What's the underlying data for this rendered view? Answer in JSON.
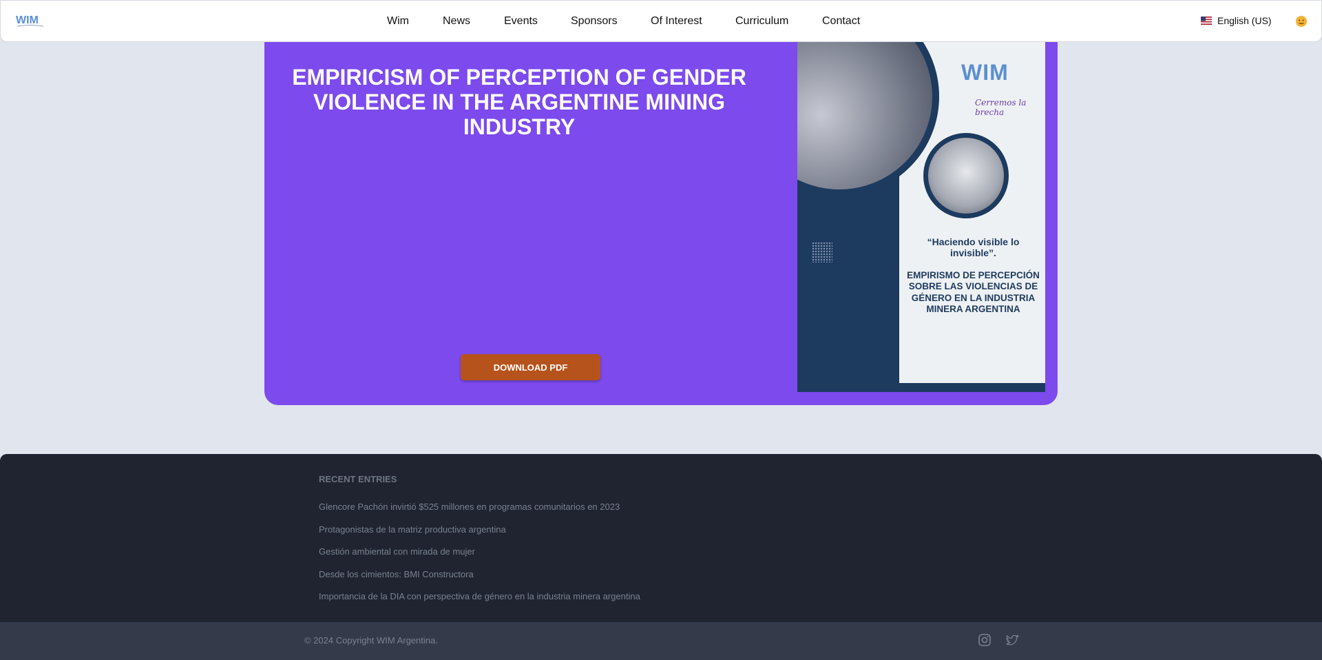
{
  "header": {
    "logo_text": "WIM",
    "nav": [
      "Wim",
      "News",
      "Events",
      "Sponsors",
      "Of Interest",
      "Curriculum",
      "Contact"
    ],
    "language": "English (US)"
  },
  "hero": {
    "title": "EMPIRICISM OF PERCEPTION OF GENDER VIOLENCE IN THE ARGENTINE MINING INDUSTRY",
    "download_label": "DOWNLOAD PDF",
    "cover": {
      "logo": "WIM",
      "tagline": "Cerremos la brecha",
      "quote": "“Haciendo visible lo invisible”.",
      "text": "EMPIRISMO DE PERCEPCIÓN SOBRE LAS VIOLENCIAS DE GÉNERO EN LA INDUSTRIA MINERA ARGENTINA"
    }
  },
  "footer": {
    "heading": "RECENT ENTRIES",
    "entries": [
      "Glencore Pachón invirtió $525 millones en programas comunitarios en 2023",
      "Protagonistas de la matriz productiva argentina",
      "Gestión ambiental con mirada de mujer",
      "Desde los cimientos: BMI Constructora",
      "Importancia de la DIA con perspectiva de género en la industria minera argentina"
    ],
    "copyright": "© 2024 Copyright WIM Argentina."
  },
  "colors": {
    "hero_bg": "#7c4aed",
    "download_button": "#b6531c",
    "footer_bg": "#1f2430",
    "page_bg": "#e1e5ee"
  }
}
